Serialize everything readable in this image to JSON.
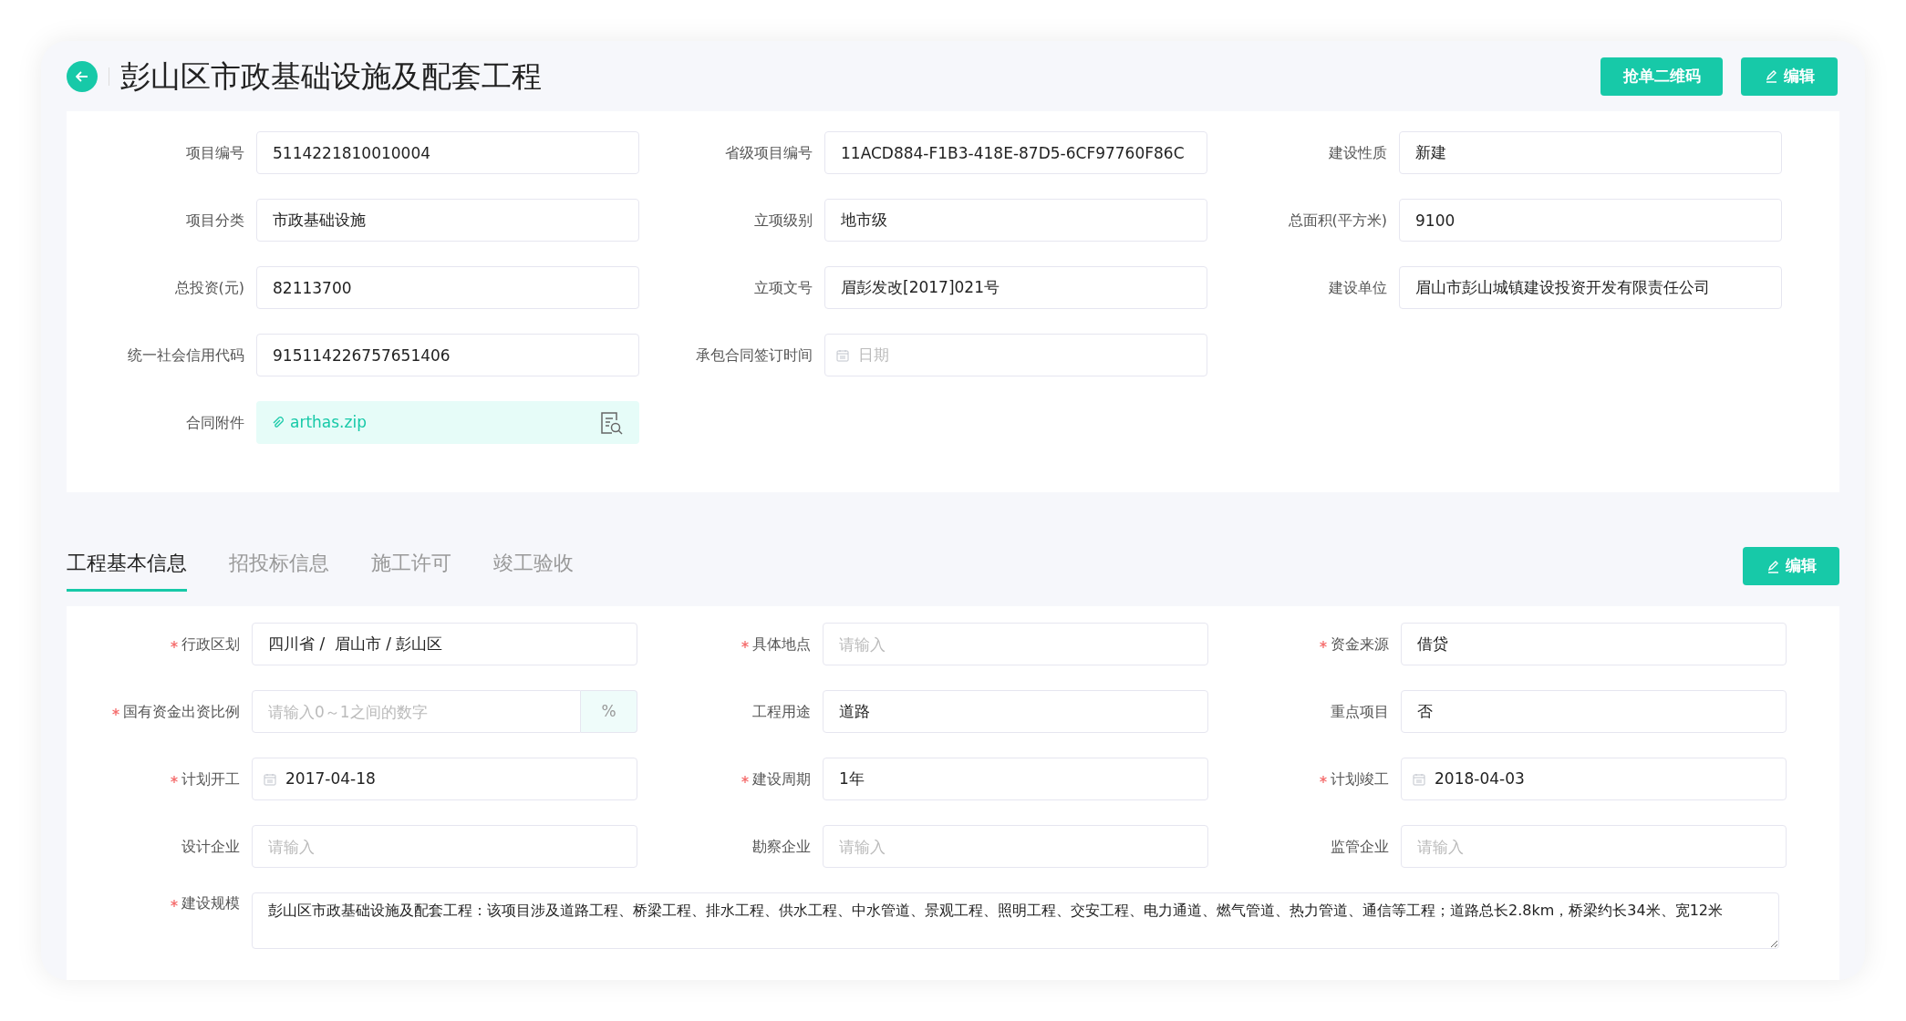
{
  "header": {
    "title": "彭山区市政基础设施及配套工程",
    "actions": [
      {
        "label": "抢单二维码",
        "kind": "plain"
      },
      {
        "label": "编辑",
        "kind": "edit"
      }
    ]
  },
  "project_info": {
    "rows": [
      [
        {
          "label": "项目编号",
          "kind": "text",
          "value": "5114221810010004"
        },
        {
          "label": "省级项目编号",
          "kind": "text",
          "value": "11ACD884-F1B3-418E-87D5-6CF97760F86C"
        },
        {
          "label": "建设性质",
          "kind": "text",
          "value": "新建"
        }
      ],
      [
        {
          "label": "项目分类",
          "kind": "text",
          "value": "市政基础设施"
        },
        {
          "label": "立项级别",
          "kind": "text",
          "value": "地市级"
        },
        {
          "label": "总面积(平方米)",
          "kind": "text",
          "value": "9100"
        }
      ],
      [
        {
          "label": "总投资(元)",
          "kind": "text",
          "value": "82113700"
        },
        {
          "label": "立项文号",
          "kind": "text",
          "value": "眉彭发改[2017]021号"
        },
        {
          "label": "建设单位",
          "kind": "text",
          "value": "眉山市彭山城镇建设投资开发有限责任公司"
        }
      ],
      [
        {
          "label": "统一社会信用代码",
          "kind": "text",
          "value": "915114226757651406"
        },
        {
          "label": "承包合同签订时间",
          "kind": "date",
          "placeholder": "日期"
        }
      ],
      [
        {
          "label": "合同附件",
          "kind": "file",
          "value": "arthas.zip"
        }
      ]
    ]
  },
  "tabs": [
    {
      "label": "工程基本信息",
      "selected": true
    },
    {
      "label": "招投标信息",
      "selected": false
    },
    {
      "label": "施工许可",
      "selected": false
    },
    {
      "label": "竣工验收",
      "selected": false
    }
  ],
  "tab_action": {
    "label": "编辑",
    "kind": "edit"
  },
  "basic_info": {
    "rows": [
      [
        {
          "label": "行政区划",
          "required": true,
          "kind": "text",
          "value": "四川省 /  眉山市 / 彭山区"
        },
        {
          "label": "具体地点",
          "required": true,
          "kind": "text",
          "placeholder": "请输入"
        },
        {
          "label": "资金来源",
          "required": true,
          "kind": "text",
          "value": "借贷"
        }
      ],
      [
        {
          "label": "国有资金出资比例",
          "required": true,
          "kind": "percent",
          "placeholder": "请输入0～1之间的数字",
          "suffix": "%"
        },
        {
          "label": "工程用途",
          "required": false,
          "kind": "text",
          "value": "道路"
        },
        {
          "label": "重点项目",
          "required": false,
          "kind": "text",
          "value": "否"
        }
      ],
      [
        {
          "label": "计划开工",
          "required": true,
          "kind": "date",
          "value": "2017-04-18"
        },
        {
          "label": "建设周期",
          "required": true,
          "kind": "text",
          "value": "1年"
        },
        {
          "label": "计划竣工",
          "required": true,
          "kind": "date",
          "value": "2018-04-03"
        }
      ],
      [
        {
          "label": "设计企业",
          "required": false,
          "kind": "text",
          "placeholder": "请输入"
        },
        {
          "label": "勘察企业",
          "required": false,
          "kind": "text",
          "placeholder": "请输入"
        },
        {
          "label": "监管企业",
          "required": false,
          "kind": "text",
          "placeholder": "请输入"
        }
      ],
      [
        {
          "label": "建设规模",
          "required": true,
          "kind": "textarea",
          "value": "彭山区市政基础设施及配套工程：该项目涉及道路工程、桥梁工程、排水工程、供水工程、中水管道、景观工程、照明工程、交安工程、电力通道、燃气管道、热力管道、通信等工程；道路总长2.8km，桥梁约长34米、宽12米"
        }
      ]
    ]
  }
}
